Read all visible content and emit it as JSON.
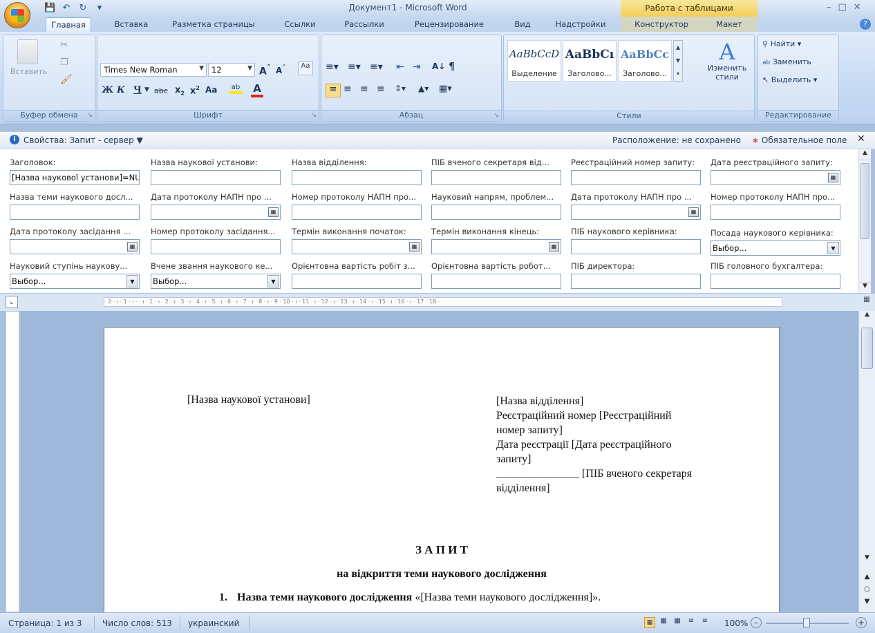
{
  "window": {
    "title": "Документ1 - Microsoft Word",
    "context_title": "Работа с таблицами"
  },
  "tabs": [
    "Главная",
    "Вставка",
    "Разметка страницы",
    "Ссылки",
    "Рассылки",
    "Рецензирование",
    "Вид",
    "Надстройки",
    "Конструктор",
    "Макет"
  ],
  "ribbon": {
    "clipboard": {
      "paste_label": "Вставить",
      "group_label": "Буфер обмена"
    },
    "font": {
      "font_name": "Times New Roman",
      "font_size": "12",
      "group_label": "Шрифт",
      "bold": "Ж",
      "italic": "К",
      "underline": "Ч",
      "aa_label": "Aa"
    },
    "paragraph": {
      "group_label": "Абзац"
    },
    "styles": {
      "group_label": "Стили",
      "items": [
        {
          "sample": "AaBbCcD",
          "name": "Выделение"
        },
        {
          "sample": "AaBbCı",
          "name": "Заголово..."
        },
        {
          "sample": "AaBbCc",
          "name": "Заголово..."
        }
      ],
      "change_label": "Изменить стили"
    },
    "editing": {
      "group_label": "Редактирование",
      "find": "Найти",
      "replace": "Заменить",
      "select": "Выделить"
    }
  },
  "properties": {
    "title": "Свойства: Запит - сервер",
    "location": "Расположение: не сохранено",
    "required": "Обязательное поле",
    "fields": [
      {
        "label": "Заголовок:",
        "value": "[Назва наукової установи]=NU"
      },
      {
        "label": "Назва наукової установи:",
        "value": ""
      },
      {
        "label": "Назва відділення:",
        "value": ""
      },
      {
        "label": "ПІБ вченого секретаря від...",
        "value": ""
      },
      {
        "label": "Реєстраційний номер запиту:",
        "value": ""
      },
      {
        "label": "Дата реєстраційного запиту:",
        "value": ""
      },
      {
        "label": "Назва теми наукового досл...",
        "value": ""
      },
      {
        "label": "Дата протоколу НАПН про ...",
        "value": ""
      },
      {
        "label": "Номер протоколу НАПН про...",
        "value": ""
      },
      {
        "label": "Науковий напрям, проблем...",
        "value": ""
      },
      {
        "label": "Дата протоколу НАПН про ...",
        "value": ""
      },
      {
        "label": "Номер протоколу НАПН про...",
        "value": ""
      },
      {
        "label": "Дата протоколу засідання ...",
        "value": ""
      },
      {
        "label": "Номер протоколу засідання...",
        "value": ""
      },
      {
        "label": "Термін виконання початок:",
        "value": ""
      },
      {
        "label": "Термін виконання кінець:",
        "value": ""
      },
      {
        "label": "ПІБ наукового керівника:",
        "value": ""
      },
      {
        "label": "Посада наукового керівника:",
        "value": "Выбор..."
      },
      {
        "label": "Науковий ступінь наукову...",
        "value": "Выбор..."
      },
      {
        "label": "Вчене звання наукового ке...",
        "value": "Выбор..."
      },
      {
        "label": "Орієнтовна вартість робіт з...",
        "value": ""
      },
      {
        "label": "Орієнтовна вартість робот...",
        "value": ""
      },
      {
        "label": "ПІБ директора:",
        "value": ""
      },
      {
        "label": "ПІБ головного бухгалтера:",
        "value": ""
      }
    ]
  },
  "ruler": "· 2 · ı · 1 · ı ·   · ı · 1 · ı · 2 · ı · 3 · ı · 4 · ı · 5 · ı · 6 · ı · 7 · ı · 8 · ı · 9   · 10 · ı · 11 · ı · 12 · ı · 13 · ı · 14 · ı · 15 · ı · 16 · ı · 17   · 18 ·",
  "document": {
    "left_header": "[Назва наукової установи]",
    "right_header": [
      "[Назва відділення]",
      "Реєстраційний номер [Реєстраційний",
      "номер запиту]",
      "Дата реєстрації [Дата реєстраційного",
      "запиту]",
      "_______________ [ПІБ вченого секретаря",
      "відділення]"
    ],
    "heading": "З А П И Т",
    "subheading": "на відкриття теми наукового дослідження",
    "item_number": "1.",
    "item_bold": "Назва теми наукового дослідження",
    "item_rest": " «[Назва теми наукового дослідження]»."
  },
  "status": {
    "page": "Страница: 1 из 3",
    "words": "Число слов: 513",
    "language": "украинский",
    "zoom": "100%"
  }
}
